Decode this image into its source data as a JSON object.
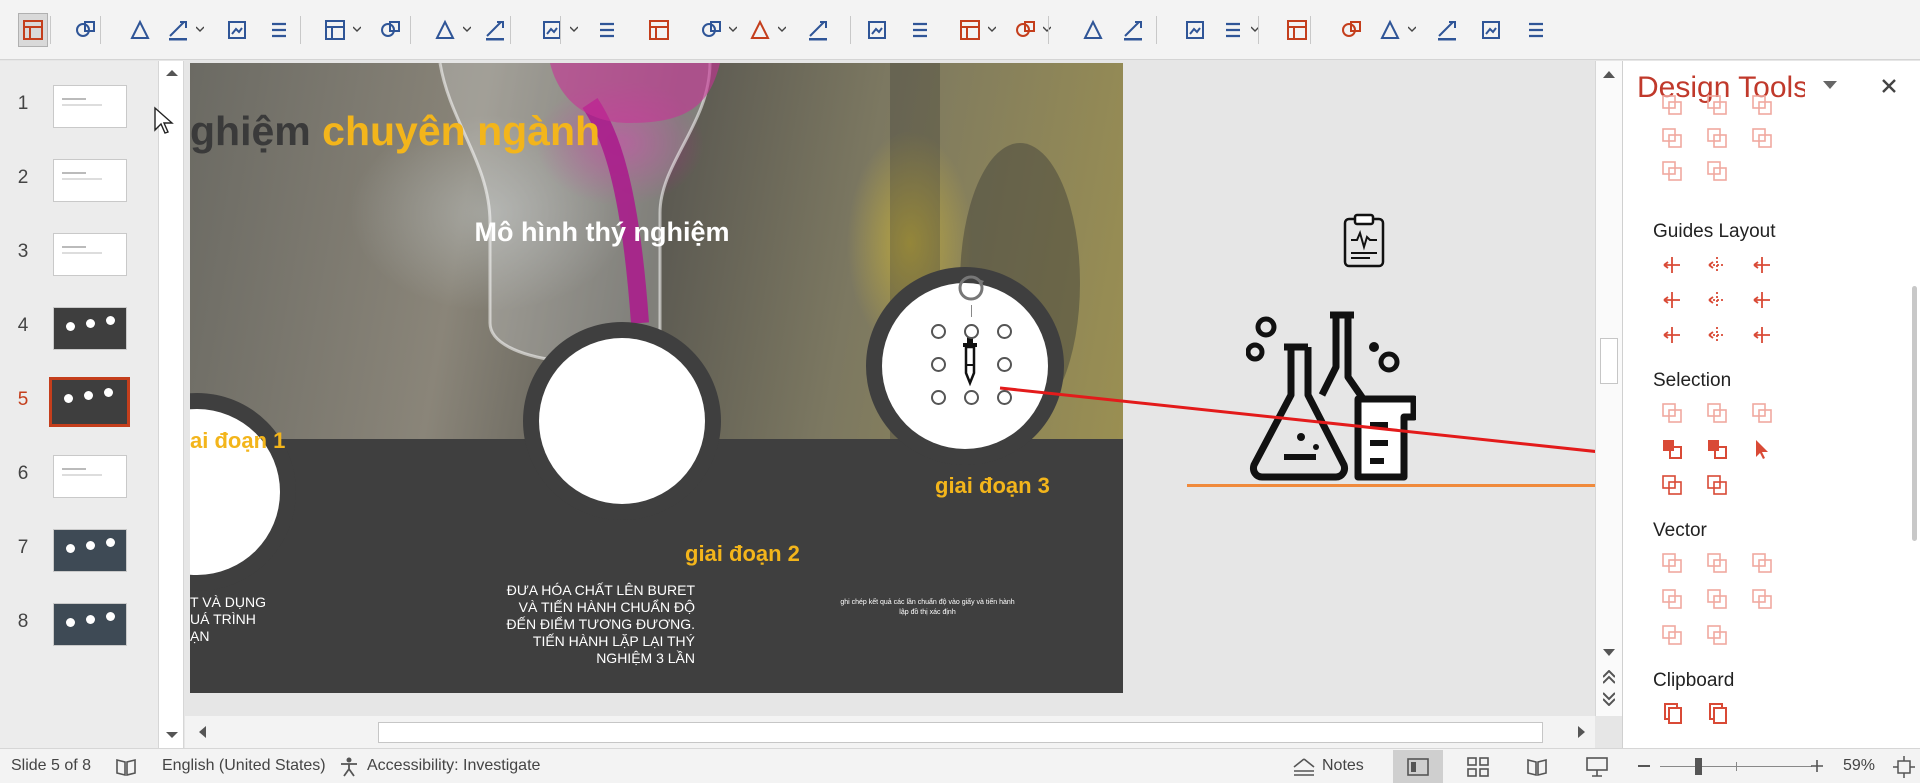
{
  "toolbar": {
    "buttons": [
      "layout",
      "export",
      "text-box",
      "shape",
      "format-painter",
      "picture-format",
      "font-color",
      "eyedropper",
      "fill",
      "fill-eyedropper",
      "line-color",
      "line-eyedropper",
      "eyedropper-red",
      "change-shape",
      "shape-options",
      "reset",
      "crop",
      "picture",
      "align",
      "distribute",
      "layer",
      "spacing",
      "slide-size",
      "layout-grid",
      "capture",
      "notes-page",
      "rotate",
      "image",
      "photo-album",
      "more"
    ],
    "colors": {
      "accent": "#c43e1c",
      "icon": "#2f5597"
    }
  },
  "thumbnails": {
    "items": [
      {
        "number": "1"
      },
      {
        "number": "2"
      },
      {
        "number": "3"
      },
      {
        "number": "4"
      },
      {
        "number": "5"
      },
      {
        "number": "6"
      },
      {
        "number": "7"
      },
      {
        "number": "8"
      }
    ],
    "current": "5"
  },
  "slide": {
    "title_part1": "ghiệm ",
    "title_part2": "chuyên ngành",
    "subtitle": "Mô hình thý nghiệm",
    "stage1": "ai đoạn 1",
    "stage2": "giai đoạn 2",
    "stage3": "giai đoạn 3",
    "body1": "t và dụng\nuá trình\nạn",
    "body2": "ĐƯA HÓA CHẤT LÊN BURET\nVÀ TIẾN HÀNH CHUẨN ĐỘ\nĐẾN ĐIỂM TƯƠNG ĐƯƠNG.\nTIẾN HÀNH LẶP LẠI THÝ\nNGHIỆM 3 LẦN",
    "body3": "ghi chép kết quả các lần chuẩn độ vào giấy và tiến hành\nlập đồ thị xác định",
    "colors": {
      "title_dark": "#3a3a3a",
      "title_accent": "#f3b51b",
      "band": "#3f3f3f",
      "arrow": "#e31b1b",
      "line": "#f08a3c"
    }
  },
  "pane": {
    "title": "Design Tools",
    "sections": {
      "guides_layout": "Guides Layout",
      "selection": "Selection",
      "vector": "Vector",
      "clipboard": "Clipboard"
    }
  },
  "status": {
    "slide_info": "Slide 5 of 8",
    "language": "English (United States)",
    "accessibility": "Accessibility: Investigate",
    "notes": "Notes",
    "zoom": "59%"
  }
}
